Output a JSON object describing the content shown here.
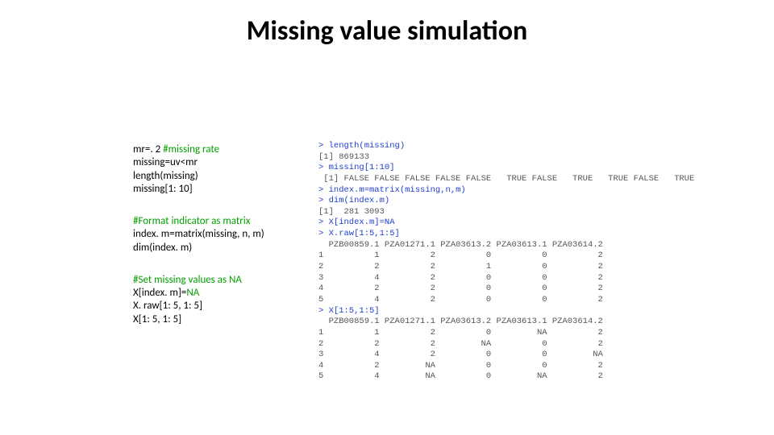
{
  "title": "Missing value simulation",
  "left": {
    "b1": {
      "l1a": "mr=. 2 ",
      "l1b": "#missing rate",
      "l2": "missing=uv<mr",
      "l3": "length(missing)",
      "l4": "missing[1: 10]"
    },
    "b2": {
      "l1": "#Format indicator as matrix",
      "l2": "index. m=matrix(missing, n, m)",
      "l3": "dim(index. m)"
    },
    "b3": {
      "l1": "#Set missing values as ",
      "l1b": "NA",
      "l2a": "X[index. m]=",
      "l2b": "NA",
      "l3": "X. raw[1: 5, 1: 5]",
      "l4": "X[1: 5, 1: 5]"
    }
  },
  "console": {
    "l1": "> length(missing)",
    "l2": "[1] 869133",
    "l3": "> missing[1:10]",
    "l4": " [1] FALSE FALSE FALSE FALSE FALSE   TRUE FALSE   TRUE   TRUE FALSE   TRUE",
    "l5": "> index.m=matrix(missing,n,m)",
    "l6": "> dim(index.m)",
    "l7": "[1]  281 3093",
    "l8": "> X[index.m]=NA",
    "l9": "> X.raw[1:5,1:5]",
    "l10": "  PZB00859.1 PZA01271.1 PZA03613.2 PZA03613.1 PZA03614.2",
    "l11": "1          1          2          0          0          2",
    "l12": "2          2          2          1          0          2",
    "l13": "3          4          2          0          0          2",
    "l14": "4          2          2          0          0          2",
    "l15": "5          4          2          0          0          2",
    "l16": "> X[1:5,1:5]",
    "l17": "  PZB00859.1 PZA01271.1 PZA03613.2 PZA03613.1 PZA03614.2",
    "l18": "1          1          2          0         NA          2",
    "l19": "2          2          2         NA          0          2",
    "l20": "3          4          2          0          0         NA",
    "l21": "4          2         NA          0          0          2",
    "l22": "5          4         NA          0         NA          2"
  }
}
